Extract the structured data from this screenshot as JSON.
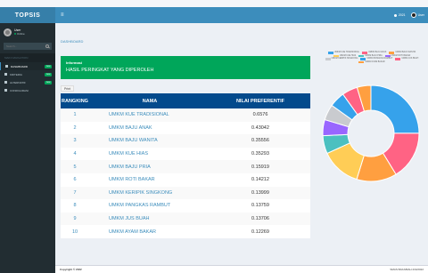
{
  "app": {
    "brand": "TOPSIS"
  },
  "user": {
    "name": "User",
    "status": "Online"
  },
  "search": {
    "placeholder": "Search..."
  },
  "sidebar": {
    "header": "MAIN NAVIGATION",
    "items": [
      {
        "label": "DASHBOARD",
        "badge": "new"
      },
      {
        "label": "KRITERIA",
        "badge": "new"
      },
      {
        "label": "ALTERNATIF",
        "badge": "new"
      },
      {
        "label": "CONFIGURASI",
        "badge": ""
      }
    ]
  },
  "topbar": {
    "menu_icon": "≡",
    "item1": "2021",
    "item2": "User"
  },
  "breadcrumb": "DASHBOARD",
  "alert": {
    "title": "Informasi",
    "text": "HASIL PERINGKAT YANG DIPEROLEH"
  },
  "print_label": "Print",
  "table": {
    "headers": {
      "rank": "RANGKING",
      "name": "NAMA",
      "value": "NILAI PREFERENTIF"
    },
    "rows": [
      {
        "rank": "1",
        "name": "UMKM KUE TRADISIONAL",
        "value": "0.6576"
      },
      {
        "rank": "2",
        "name": "UMKM BAJU ANAK",
        "value": "0.43042"
      },
      {
        "rank": "3",
        "name": "UMKM BAJU WANITA",
        "value": "0.35556"
      },
      {
        "rank": "4",
        "name": "UMKM KUE HIAS",
        "value": "0.35293"
      },
      {
        "rank": "5",
        "name": "UMKM BAJU PRIA",
        "value": "0.15919"
      },
      {
        "rank": "6",
        "name": "UMKM ROTI BAKAR",
        "value": "0.14212"
      },
      {
        "rank": "7",
        "name": "UMKM KERIPIK SINGKONG",
        "value": "0.13999"
      },
      {
        "rank": "8",
        "name": "UMKM PANGKAS RAMBUT",
        "value": "0.13759"
      },
      {
        "rank": "9",
        "name": "UMKM JUS BUAH",
        "value": "0.13706"
      },
      {
        "rank": "10",
        "name": "UMKM AYAM BAKAR",
        "value": "0.12269"
      }
    ]
  },
  "chart_data": {
    "type": "pie",
    "donut": true,
    "categories": [
      "UMKM KUE TRADISIONAL",
      "UMKM BAJU ANAK",
      "UMKM BAJU WANITA",
      "UMKM KUE HIAS",
      "UMKM BAJU PRIA",
      "UMKM ROTI BAKAR",
      "UMKM KERIPIK SINGKONG",
      "UMKM PANGKAS RAMBUT",
      "UMKM JUS BUAH",
      "UMKM AYAM BAKAR"
    ],
    "values": [
      0.6576,
      0.43042,
      0.35556,
      0.35293,
      0.15919,
      0.14212,
      0.13999,
      0.13759,
      0.13706,
      0.12269
    ],
    "colors": [
      "#36a2eb",
      "#ff6384",
      "#ff9f40",
      "#ffcd56",
      "#4bc0c0",
      "#9966ff",
      "#c9cbcf",
      "#36a2eb",
      "#ff6384",
      "#ff9f40"
    ],
    "legend_position": "top"
  },
  "footer": {
    "left": "Copyright © 2022",
    "right": "SMAS BAKABIAH 234/2022"
  }
}
